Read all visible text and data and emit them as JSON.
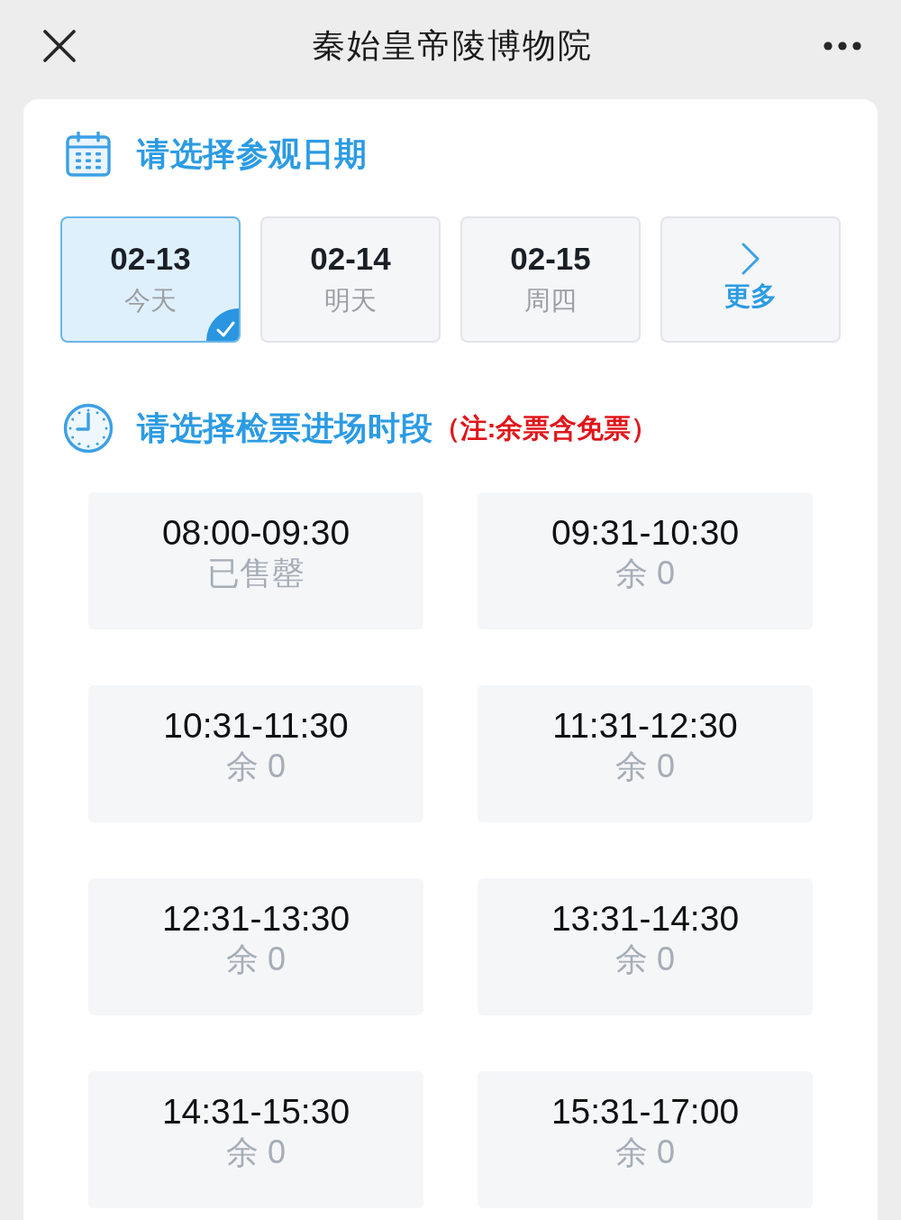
{
  "window": {
    "title": "秦始皇帝陵博物院"
  },
  "date_section": {
    "title": "请选择参观日期",
    "dates": [
      {
        "kind": "date",
        "date": "02-13",
        "day": "今天",
        "selected": true
      },
      {
        "kind": "date",
        "date": "02-14",
        "day": "明天",
        "selected": false
      },
      {
        "kind": "date",
        "date": "02-15",
        "day": "周四",
        "selected": false
      },
      {
        "kind": "more",
        "label": "更多",
        "selected": false
      }
    ]
  },
  "time_section": {
    "title": "请选择检票进场时段",
    "note": "（注:余票含免票）",
    "slots": [
      {
        "time": "08:00-09:30",
        "status": "已售罄"
      },
      {
        "time": "09:31-10:30",
        "status": "余 0"
      },
      {
        "time": "10:31-11:30",
        "status": "余 0"
      },
      {
        "time": "11:31-12:30",
        "status": "余 0"
      },
      {
        "time": "12:31-13:30",
        "status": "余 0"
      },
      {
        "time": "13:31-14:30",
        "status": "余 0"
      },
      {
        "time": "14:31-15:30",
        "status": "余 0"
      },
      {
        "time": "15:31-17:00",
        "status": "余 0"
      }
    ]
  }
}
